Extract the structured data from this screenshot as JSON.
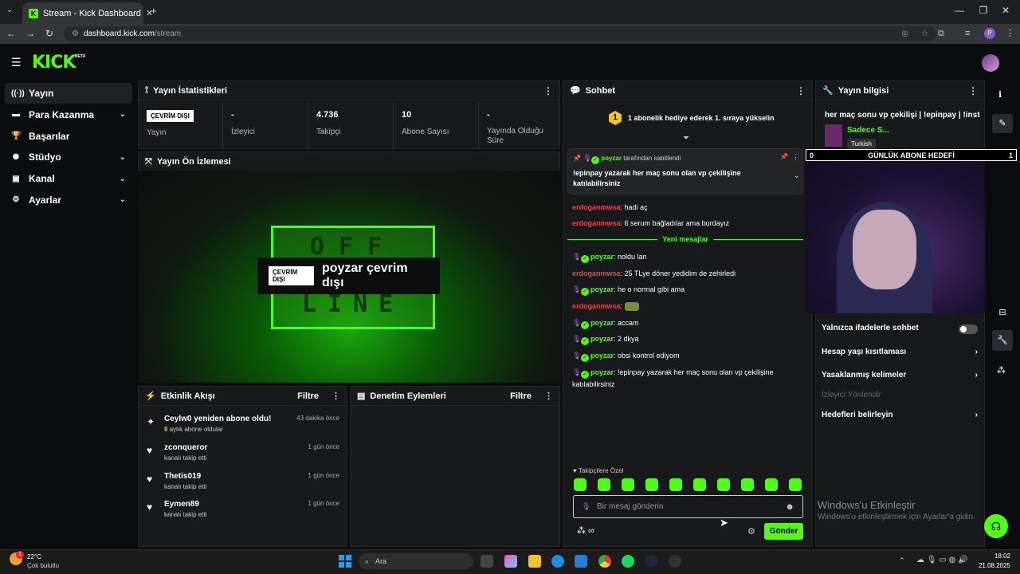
{
  "browser": {
    "tab_title": "Stream - Kick Dashboard",
    "url_host": "dashboard.kick.com",
    "url_path": "/stream",
    "profile_letter": "P"
  },
  "brand": {
    "logo": "KICK",
    "beta": "BETA",
    "accent": "#53fc18"
  },
  "sidebar": {
    "items": [
      {
        "label": "Yayın",
        "icon": "broadcast-icon",
        "active": true,
        "expandable": false
      },
      {
        "label": "Para Kazanma",
        "icon": "money-icon",
        "expandable": true
      },
      {
        "label": "Başarılar",
        "icon": "trophy-icon",
        "expandable": false
      },
      {
        "label": "Stüdyo",
        "icon": "studio-icon",
        "expandable": true
      },
      {
        "label": "Kanal",
        "icon": "channel-icon",
        "expandable": true
      },
      {
        "label": "Ayarlar",
        "icon": "gear-icon",
        "expandable": true
      }
    ]
  },
  "stats": {
    "title": "Yayın İstatistikleri",
    "status_badge": "ÇEVRİM DIŞI",
    "status_label": "Yayın",
    "cells": [
      {
        "value": "-",
        "label": "İzleyici"
      },
      {
        "value": "4.736",
        "label": "Takipçi"
      },
      {
        "value": "10",
        "label": "Abone Sayısı"
      },
      {
        "value": "-",
        "label": "Yayında Olduğu Süre"
      }
    ]
  },
  "preview": {
    "title": "Yayın Ön İzlemesi",
    "badge": "ÇEVRİM DIŞI",
    "text": "poyzar çevrim dışı",
    "sign_top": "OFF",
    "sign_bottom": "LINE"
  },
  "activity": {
    "title": "Etkinlik Akışı",
    "filter": "Filtre",
    "items": [
      {
        "name": "Ceylw0 yeniden abone oldu!",
        "sub_prefix": "8",
        "sub": " aylık abone oldular",
        "time": "43 dakika önce",
        "icon": "sparkle-icon"
      },
      {
        "name": "zconqueror",
        "sub": "kanalı takip etti",
        "time": "1 gün önce",
        "icon": "heart-icon"
      },
      {
        "name": "Thetis019",
        "sub": "kanalı takip etti",
        "time": "1 gün önce",
        "icon": "heart-icon"
      },
      {
        "name": "Eymen89",
        "sub": "kanalı takip etti",
        "time": "1 gün önce",
        "icon": "heart-icon"
      }
    ]
  },
  "moderation": {
    "title": "Denetim Eylemleri",
    "filter": "Filtre"
  },
  "chat": {
    "title": "Sohbet",
    "gift_text": "1 abonelik hediye ederek 1. sıraya yükselin",
    "gift_rank": "1",
    "pinned_by_user": "poyzar",
    "pinned_by_text": " tarafından sabitlendi",
    "pinned_message": "!epinpay yazarak her maç sonu olan vp çekilişine katılabilirsiniz",
    "new_messages": "Yeni mesajlar",
    "messages": [
      {
        "user": "erdoganmwsa",
        "text": " hadi aç",
        "role": "viewer"
      },
      {
        "user": "erdoganmwsa",
        "text": " 6 serum bağladılar ama burdayız",
        "role": "viewer"
      },
      {
        "user": "poyzar",
        "text": " noldu lan",
        "role": "host"
      },
      {
        "user": "erdoganmwsa",
        "text": " 25 TLye döner yedidim de zehirledi",
        "role": "viewer"
      },
      {
        "user": "poyzar",
        "text": " he o normal gibi ama",
        "role": "host"
      },
      {
        "user": "erdoganmwsa",
        "text": " ",
        "role": "viewer",
        "emote": true
      },
      {
        "user": "poyzar",
        "text": " accam",
        "role": "host"
      },
      {
        "user": "poyzar",
        "text": " 2 dkya",
        "role": "host"
      },
      {
        "user": "poyzar",
        "text": " obsi kontrol ediyom",
        "role": "host"
      },
      {
        "user": "poyzar",
        "text": " !epinpay yazarak her maç sonu olan vp çekilişine katılabilirsiniz",
        "role": "host"
      }
    ],
    "emote_section": "Takipçilere Özel",
    "input_placeholder": "Bir mesaj gönderin",
    "send": "Gönder"
  },
  "stream_info": {
    "title": "Yayın bilgisi",
    "stream_title": "her maç sonu vp çekilişi | !epinpay | !insta",
    "streamer_name": "Sadece S...",
    "language": "Turkish",
    "goal_left": "0",
    "goal_label": "GÜNLÜK ABONE HEDEFİ",
    "goal_right": "1",
    "settings": [
      {
        "label": "Yalnızca ifadelerle sohbet",
        "type": "toggle",
        "on": false
      },
      {
        "label": "Hesap yaşı kısıtlaması",
        "type": "chevron"
      },
      {
        "label": "Yasaklanmış kelimeler",
        "type": "chevron"
      },
      {
        "label": "İzleyici Yönlendir",
        "type": "disabled"
      },
      {
        "label": "Hedefleri belirleyin",
        "type": "chevron"
      }
    ]
  },
  "watermark": {
    "line1": "Windows'u Etkinleştir",
    "line2": "Windows'u etkinleştirmek için Ayarlar'a gidin."
  },
  "taskbar": {
    "temp": "22°C",
    "weather": "Çok bulutlu",
    "search": "Ara",
    "time": "18:02",
    "date": "21.08.2025",
    "notif_count": "1"
  }
}
